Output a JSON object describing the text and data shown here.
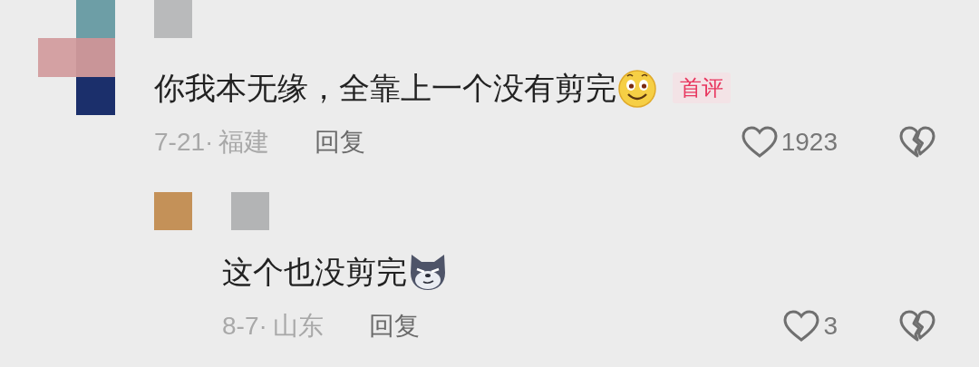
{
  "comment": {
    "text": "你我本无缘，全靠上一个没有剪完",
    "badge": "首评",
    "date": "7-21·",
    "location": "福建",
    "reply_label": "回复",
    "like_count": "1923"
  },
  "replies": [
    {
      "text": "这个也没剪完",
      "date": "8-7·",
      "location": "山东",
      "reply_label": "回复",
      "like_count": "3"
    }
  ]
}
